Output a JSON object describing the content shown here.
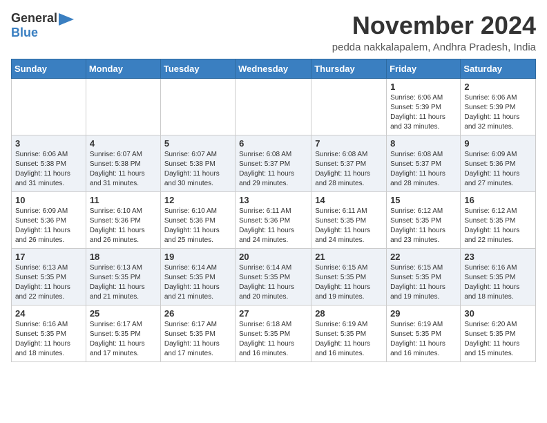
{
  "header": {
    "logo_general": "General",
    "logo_blue": "Blue",
    "month_title": "November 2024",
    "location": "pedda nakkalapalem, Andhra Pradesh, India"
  },
  "days_of_week": [
    "Sunday",
    "Monday",
    "Tuesday",
    "Wednesday",
    "Thursday",
    "Friday",
    "Saturday"
  ],
  "weeks": [
    [
      {
        "day": "",
        "info": ""
      },
      {
        "day": "",
        "info": ""
      },
      {
        "day": "",
        "info": ""
      },
      {
        "day": "",
        "info": ""
      },
      {
        "day": "",
        "info": ""
      },
      {
        "day": "1",
        "info": "Sunrise: 6:06 AM\nSunset: 5:39 PM\nDaylight: 11 hours and 33 minutes."
      },
      {
        "day": "2",
        "info": "Sunrise: 6:06 AM\nSunset: 5:39 PM\nDaylight: 11 hours and 32 minutes."
      }
    ],
    [
      {
        "day": "3",
        "info": "Sunrise: 6:06 AM\nSunset: 5:38 PM\nDaylight: 11 hours and 31 minutes."
      },
      {
        "day": "4",
        "info": "Sunrise: 6:07 AM\nSunset: 5:38 PM\nDaylight: 11 hours and 31 minutes."
      },
      {
        "day": "5",
        "info": "Sunrise: 6:07 AM\nSunset: 5:38 PM\nDaylight: 11 hours and 30 minutes."
      },
      {
        "day": "6",
        "info": "Sunrise: 6:08 AM\nSunset: 5:37 PM\nDaylight: 11 hours and 29 minutes."
      },
      {
        "day": "7",
        "info": "Sunrise: 6:08 AM\nSunset: 5:37 PM\nDaylight: 11 hours and 28 minutes."
      },
      {
        "day": "8",
        "info": "Sunrise: 6:08 AM\nSunset: 5:37 PM\nDaylight: 11 hours and 28 minutes."
      },
      {
        "day": "9",
        "info": "Sunrise: 6:09 AM\nSunset: 5:36 PM\nDaylight: 11 hours and 27 minutes."
      }
    ],
    [
      {
        "day": "10",
        "info": "Sunrise: 6:09 AM\nSunset: 5:36 PM\nDaylight: 11 hours and 26 minutes."
      },
      {
        "day": "11",
        "info": "Sunrise: 6:10 AM\nSunset: 5:36 PM\nDaylight: 11 hours and 26 minutes."
      },
      {
        "day": "12",
        "info": "Sunrise: 6:10 AM\nSunset: 5:36 PM\nDaylight: 11 hours and 25 minutes."
      },
      {
        "day": "13",
        "info": "Sunrise: 6:11 AM\nSunset: 5:36 PM\nDaylight: 11 hours and 24 minutes."
      },
      {
        "day": "14",
        "info": "Sunrise: 6:11 AM\nSunset: 5:35 PM\nDaylight: 11 hours and 24 minutes."
      },
      {
        "day": "15",
        "info": "Sunrise: 6:12 AM\nSunset: 5:35 PM\nDaylight: 11 hours and 23 minutes."
      },
      {
        "day": "16",
        "info": "Sunrise: 6:12 AM\nSunset: 5:35 PM\nDaylight: 11 hours and 22 minutes."
      }
    ],
    [
      {
        "day": "17",
        "info": "Sunrise: 6:13 AM\nSunset: 5:35 PM\nDaylight: 11 hours and 22 minutes."
      },
      {
        "day": "18",
        "info": "Sunrise: 6:13 AM\nSunset: 5:35 PM\nDaylight: 11 hours and 21 minutes."
      },
      {
        "day": "19",
        "info": "Sunrise: 6:14 AM\nSunset: 5:35 PM\nDaylight: 11 hours and 21 minutes."
      },
      {
        "day": "20",
        "info": "Sunrise: 6:14 AM\nSunset: 5:35 PM\nDaylight: 11 hours and 20 minutes."
      },
      {
        "day": "21",
        "info": "Sunrise: 6:15 AM\nSunset: 5:35 PM\nDaylight: 11 hours and 19 minutes."
      },
      {
        "day": "22",
        "info": "Sunrise: 6:15 AM\nSunset: 5:35 PM\nDaylight: 11 hours and 19 minutes."
      },
      {
        "day": "23",
        "info": "Sunrise: 6:16 AM\nSunset: 5:35 PM\nDaylight: 11 hours and 18 minutes."
      }
    ],
    [
      {
        "day": "24",
        "info": "Sunrise: 6:16 AM\nSunset: 5:35 PM\nDaylight: 11 hours and 18 minutes."
      },
      {
        "day": "25",
        "info": "Sunrise: 6:17 AM\nSunset: 5:35 PM\nDaylight: 11 hours and 17 minutes."
      },
      {
        "day": "26",
        "info": "Sunrise: 6:17 AM\nSunset: 5:35 PM\nDaylight: 11 hours and 17 minutes."
      },
      {
        "day": "27",
        "info": "Sunrise: 6:18 AM\nSunset: 5:35 PM\nDaylight: 11 hours and 16 minutes."
      },
      {
        "day": "28",
        "info": "Sunrise: 6:19 AM\nSunset: 5:35 PM\nDaylight: 11 hours and 16 minutes."
      },
      {
        "day": "29",
        "info": "Sunrise: 6:19 AM\nSunset: 5:35 PM\nDaylight: 11 hours and 16 minutes."
      },
      {
        "day": "30",
        "info": "Sunrise: 6:20 AM\nSunset: 5:35 PM\nDaylight: 11 hours and 15 minutes."
      }
    ]
  ]
}
